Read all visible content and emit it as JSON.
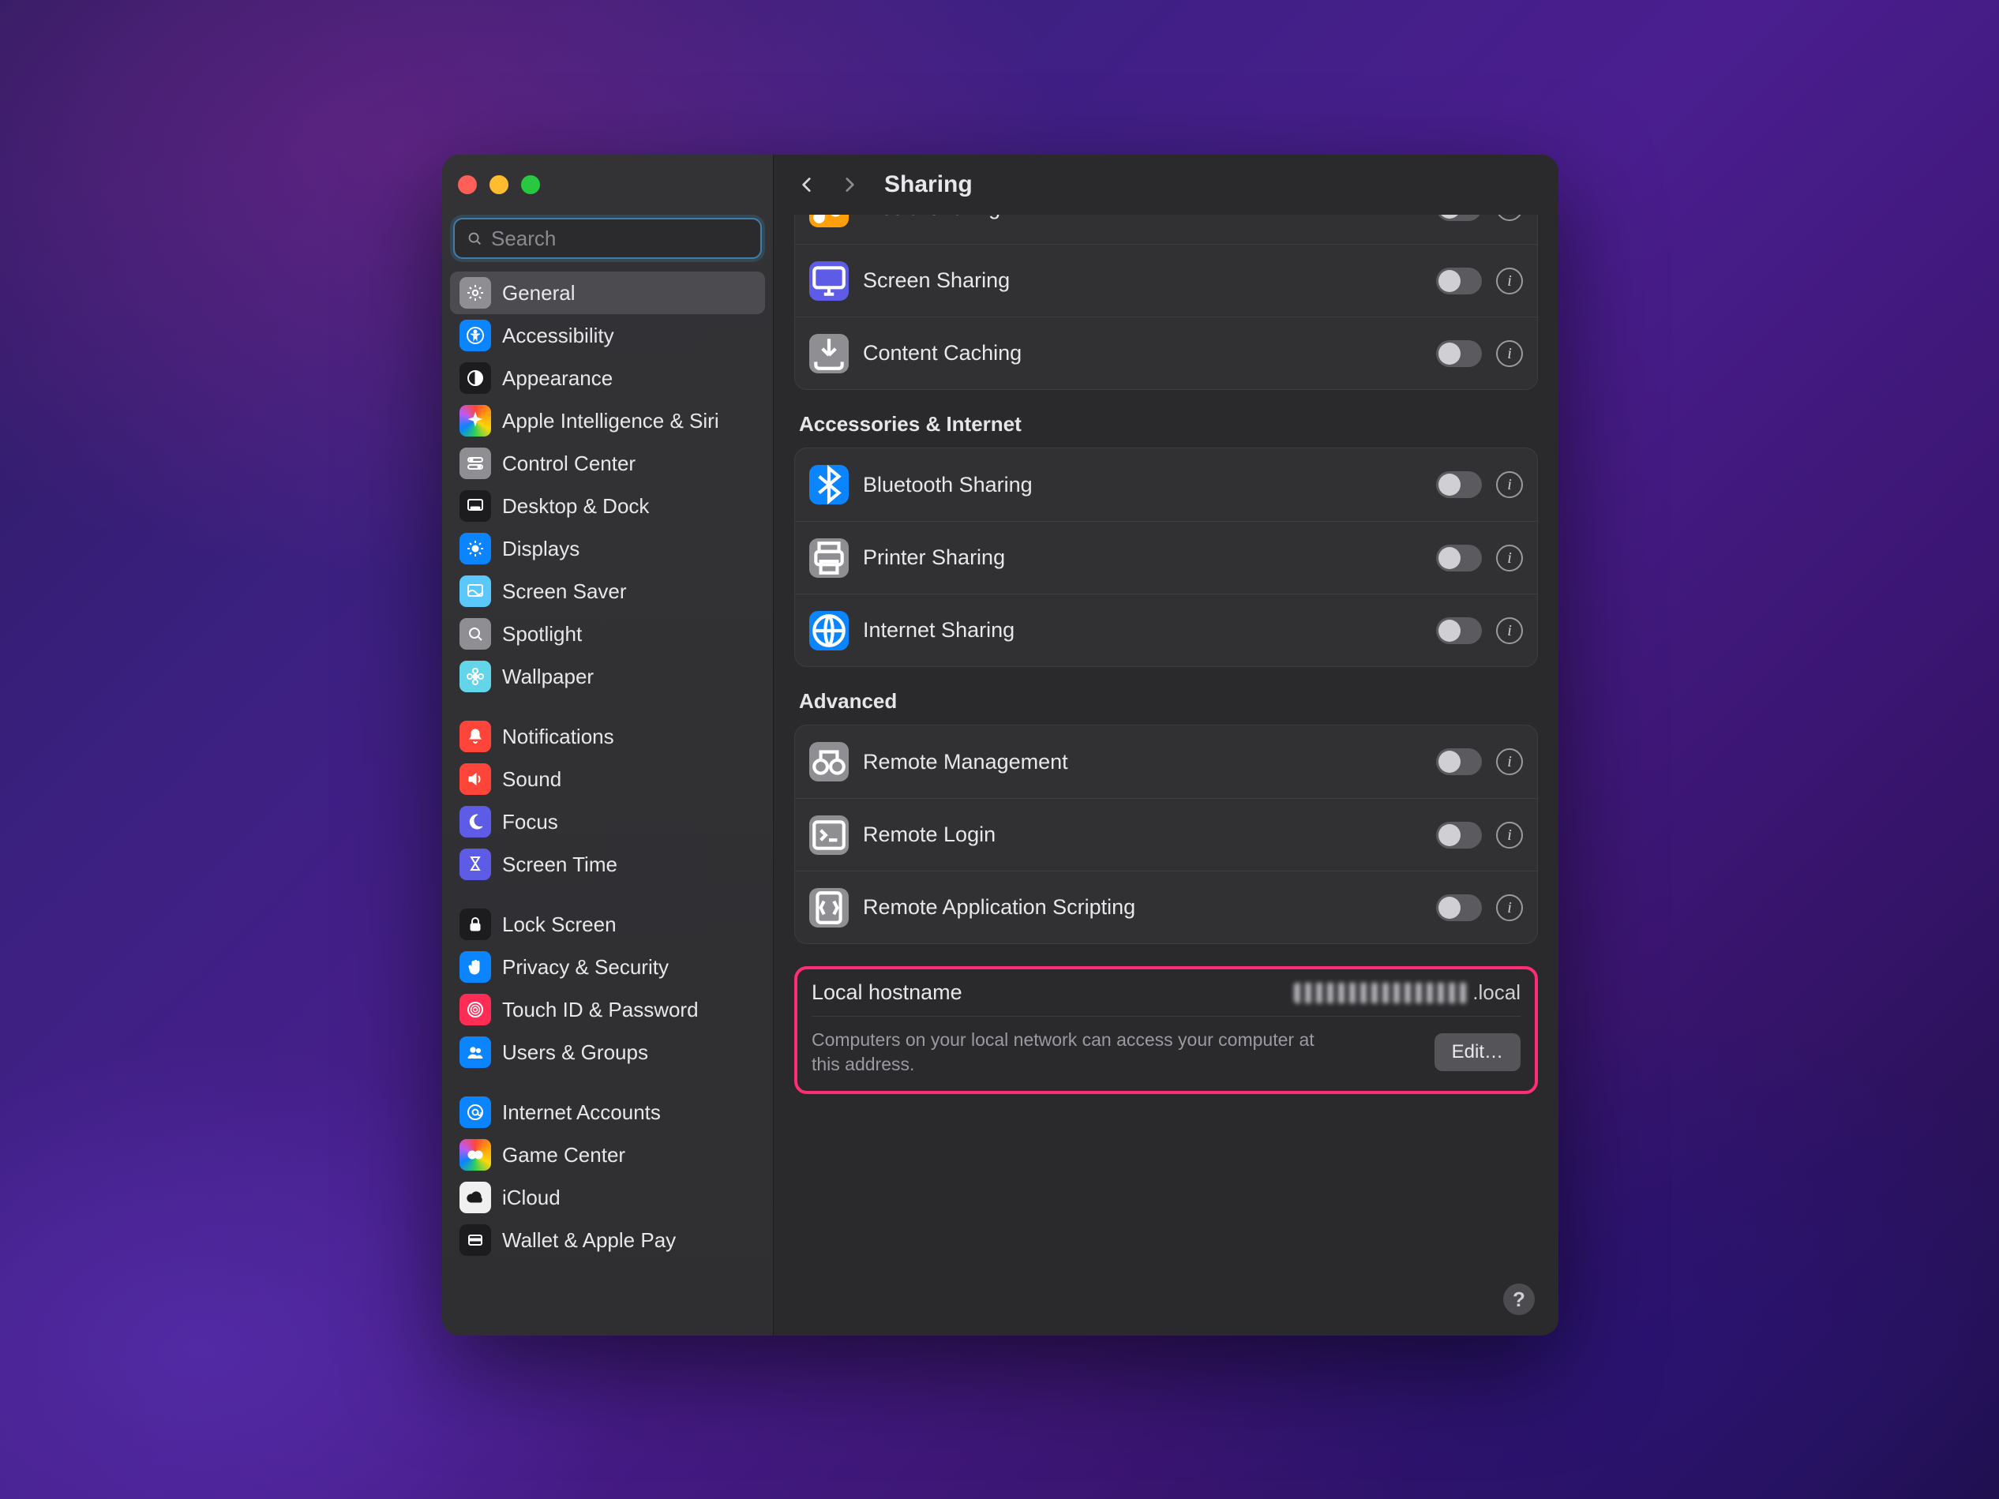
{
  "window": {
    "title": "Sharing"
  },
  "search": {
    "placeholder": "Search"
  },
  "sidebar": {
    "groups": [
      [
        {
          "id": "general",
          "label": "General",
          "selected": true,
          "iconBg": "bg-gray",
          "icon": "gear-icon"
        },
        {
          "id": "accessibility",
          "label": "Accessibility",
          "iconBg": "bg-blue",
          "icon": "accessibility-icon"
        },
        {
          "id": "appearance",
          "label": "Appearance",
          "iconBg": "bg-black",
          "icon": "appearance-icon"
        },
        {
          "id": "apple-intelligence",
          "label": "Apple Intelligence & Siri",
          "iconBg": "bg-rainbow",
          "icon": "sparkle-icon"
        },
        {
          "id": "control-center",
          "label": "Control Center",
          "iconBg": "bg-gray",
          "icon": "switches-icon"
        },
        {
          "id": "desktop-dock",
          "label": "Desktop & Dock",
          "iconBg": "bg-black",
          "icon": "dock-icon"
        },
        {
          "id": "displays",
          "label": "Displays",
          "iconBg": "bg-blue",
          "icon": "sun-icon"
        },
        {
          "id": "screen-saver",
          "label": "Screen Saver",
          "iconBg": "bg-lblue",
          "icon": "screensaver-icon"
        },
        {
          "id": "spotlight",
          "label": "Spotlight",
          "iconBg": "bg-gray",
          "icon": "search-icon"
        },
        {
          "id": "wallpaper",
          "label": "Wallpaper",
          "iconBg": "bg-cyan",
          "icon": "flower-icon"
        }
      ],
      [
        {
          "id": "notifications",
          "label": "Notifications",
          "iconBg": "bg-red",
          "icon": "bell-icon"
        },
        {
          "id": "sound",
          "label": "Sound",
          "iconBg": "bg-red",
          "icon": "speaker-icon"
        },
        {
          "id": "focus",
          "label": "Focus",
          "iconBg": "bg-indigo",
          "icon": "moon-icon"
        },
        {
          "id": "screen-time",
          "label": "Screen Time",
          "iconBg": "bg-indigo",
          "icon": "hourglass-icon"
        }
      ],
      [
        {
          "id": "lock-screen",
          "label": "Lock Screen",
          "iconBg": "bg-black",
          "icon": "lock-icon"
        },
        {
          "id": "privacy-security",
          "label": "Privacy & Security",
          "iconBg": "bg-blue",
          "icon": "hand-icon"
        },
        {
          "id": "touch-id",
          "label": "Touch ID & Password",
          "iconBg": "bg-pink",
          "icon": "fingerprint-icon"
        },
        {
          "id": "users-groups",
          "label": "Users & Groups",
          "iconBg": "bg-blue",
          "icon": "users-icon"
        }
      ],
      [
        {
          "id": "internet-accounts",
          "label": "Internet Accounts",
          "iconBg": "bg-blue",
          "icon": "at-icon"
        },
        {
          "id": "game-center",
          "label": "Game Center",
          "iconBg": "bg-rainbow",
          "icon": "game-icon"
        },
        {
          "id": "icloud",
          "label": "iCloud",
          "iconBg": "bg-white",
          "icon": "cloud-icon"
        },
        {
          "id": "wallet",
          "label": "Wallet & Apple Pay",
          "iconBg": "bg-black",
          "icon": "wallet-icon"
        }
      ]
    ]
  },
  "sections": [
    {
      "title": "",
      "rows": [
        {
          "id": "media-sharing",
          "label": "Media Sharing",
          "icon": "music-icon",
          "iconBg": "bg-orange",
          "on": false,
          "partial": true
        },
        {
          "id": "screen-sharing",
          "label": "Screen Sharing",
          "icon": "display-icon",
          "iconBg": "bg-indigo",
          "on": false
        },
        {
          "id": "content-caching",
          "label": "Content Caching",
          "icon": "download-icon",
          "iconBg": "bg-gray",
          "on": false
        }
      ]
    },
    {
      "title": "Accessories & Internet",
      "rows": [
        {
          "id": "bluetooth-sharing",
          "label": "Bluetooth Sharing",
          "icon": "bluetooth-icon",
          "iconBg": "bg-blue",
          "on": false
        },
        {
          "id": "printer-sharing",
          "label": "Printer Sharing",
          "icon": "printer-icon",
          "iconBg": "bg-gray",
          "on": false
        },
        {
          "id": "internet-sharing",
          "label": "Internet Sharing",
          "icon": "globe-icon",
          "iconBg": "bg-blue",
          "on": false
        }
      ]
    },
    {
      "title": "Advanced",
      "rows": [
        {
          "id": "remote-management",
          "label": "Remote Management",
          "icon": "binoculars-icon",
          "iconBg": "bg-gray",
          "on": false
        },
        {
          "id": "remote-login",
          "label": "Remote Login",
          "icon": "terminal-icon",
          "iconBg": "bg-gray",
          "on": false
        },
        {
          "id": "remote-scripting",
          "label": "Remote Application Scripting",
          "icon": "script-icon",
          "iconBg": "bg-gray",
          "on": false
        }
      ]
    }
  ],
  "hostname": {
    "label": "Local hostname",
    "value_suffix": ".local",
    "description": "Computers on your local network can access your computer at this address.",
    "edit_label": "Edit…"
  },
  "help_label": "?"
}
